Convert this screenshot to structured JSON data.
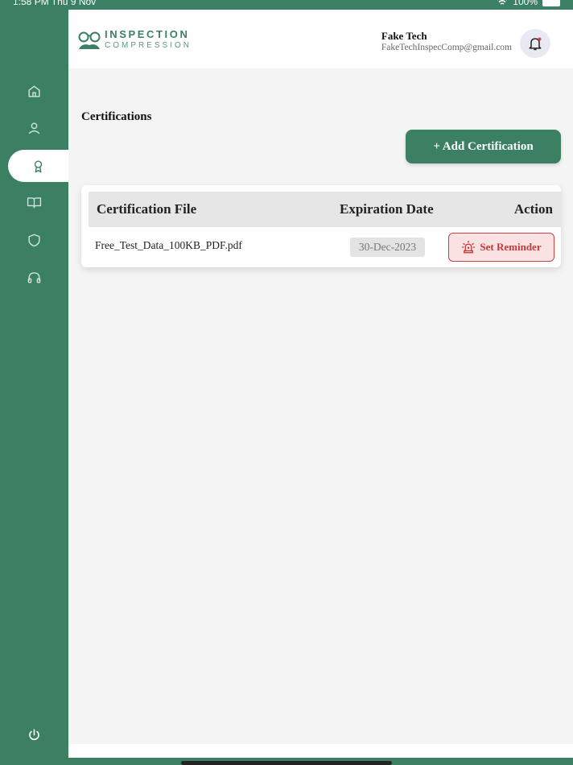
{
  "status": {
    "time": "1:58 PM  Thu 9 Nov",
    "battery": "100%"
  },
  "logo": {
    "top": "INSPECTION",
    "bottom": "COMPRESSION"
  },
  "user": {
    "name": "Fake Tech",
    "email": "FakeTechInspecComp@gmail.com"
  },
  "page": {
    "title": "Certifications",
    "add_label": "+ Add Certification"
  },
  "table": {
    "headers": [
      "Certification File",
      "Expiration Date",
      "Action"
    ],
    "rows": [
      {
        "file": "Free_Test_Data_100KB_PDF.pdf",
        "expiration": "30-Dec-2023",
        "action": "Set Reminder"
      }
    ]
  },
  "nav": {
    "items": [
      "home-icon",
      "user-icon",
      "award-icon",
      "book-icon",
      "shield-icon",
      "headphones-icon"
    ],
    "active": "award-icon",
    "footer": "power-icon"
  },
  "colors": {
    "primary": "#3b8063",
    "danger": "#c93838",
    "danger_bg": "#fbe2e2"
  }
}
